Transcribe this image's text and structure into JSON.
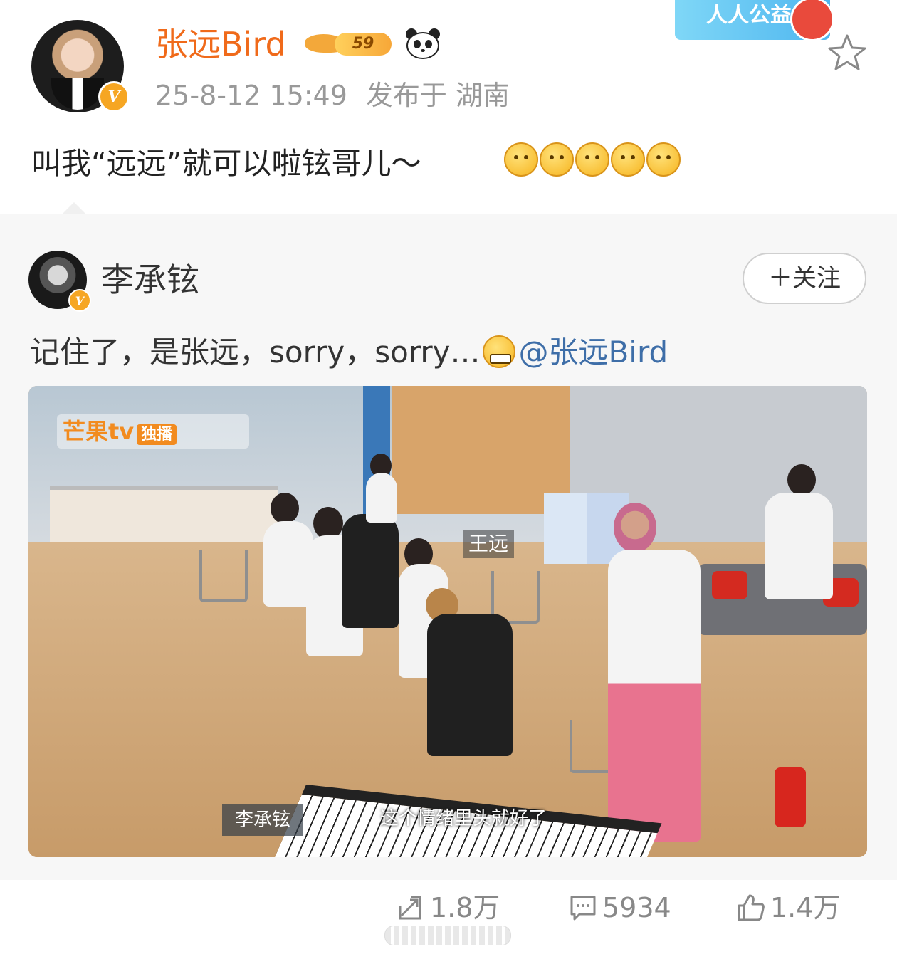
{
  "header": {
    "username": "张远Bird",
    "level": "59",
    "timestamp": "25-8-12 15:49",
    "location": "发布于 湖南",
    "banner_text": "人人公益"
  },
  "post": {
    "text": "叫我“远远”就可以啦铉哥儿～"
  },
  "repost": {
    "author": "李承铉",
    "follow_label": "＋关注",
    "text": "记住了，是张远，sorry，sorry…",
    "mention": "@张远Bird",
    "video": {
      "logo": "芒果tv",
      "logo_tag": "独播",
      "name_tag": "王远",
      "speaker": "李承铉",
      "subtitle": "这个情绪里头就好了"
    }
  },
  "actions": {
    "repost_count": "1.8万",
    "comment_count": "5934",
    "like_count": "1.4万"
  },
  "icons": [
    "verified-badge-icon",
    "star-icon",
    "panda-icon",
    "repost-icon",
    "comment-icon",
    "like-icon"
  ],
  "colors": {
    "username": "#f06a1a",
    "mention": "#3e6ea8",
    "meta_gray": "#999999",
    "verified": "#f6a623"
  }
}
